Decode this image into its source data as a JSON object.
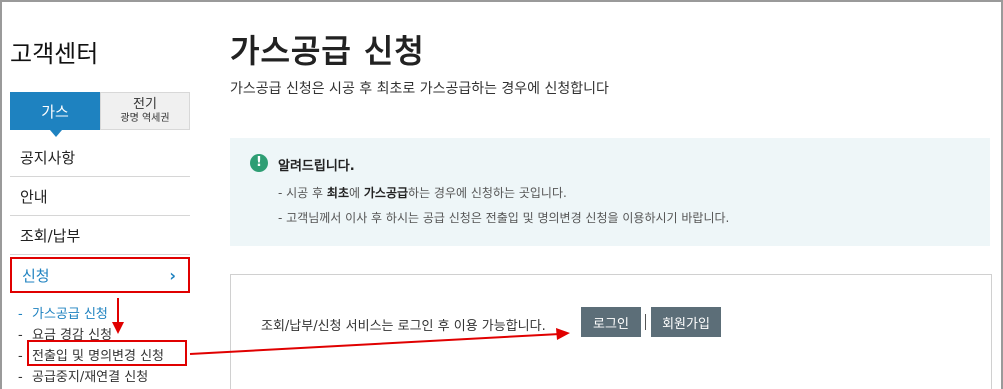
{
  "sidebar": {
    "title": "고객센터",
    "tabs": {
      "gas": "가스",
      "electric": "전기",
      "electric_sub": "광명 역세권"
    },
    "menu": [
      {
        "label": "공지사항"
      },
      {
        "label": "안내"
      },
      {
        "label": "조회/납부"
      },
      {
        "label": "신청",
        "chevron": "›"
      }
    ],
    "submenu": [
      {
        "dash": "-",
        "label": "가스공급 신청"
      },
      {
        "dash": "-",
        "label": "요금 경감 신청"
      },
      {
        "dash": "-",
        "label": "전출입 및 명의변경 신청"
      },
      {
        "dash": "-",
        "label": "공급중지/재연결 신청"
      }
    ]
  },
  "main": {
    "title": "가스공급 신청",
    "subtitle": "가스공급 신청은 시공 후 최초로 가스공급하는 경우에 신청합니다",
    "notice": {
      "icon": "!",
      "title": "알려드립니다.",
      "line1_pre": "- 시공 후 ",
      "line1_b1": "최초",
      "line1_mid": "에 ",
      "line1_b2": "가스공급",
      "line1_post": "하는 경우에 신청하는 곳입니다.",
      "line2": "- 고객님께서 이사 후 하시는 공급 신청은 전출입 및 명의변경 신청을 이용하시기 바랍니다."
    },
    "login": {
      "text": "조회/납부/신청 서비스는 로그인 후 이용 가능합니다.",
      "login_button": "로그인",
      "join_button": "회원가입"
    }
  },
  "colors": {
    "accent": "#1e82c0",
    "annotation": "#e00000",
    "button": "#5c6e78",
    "notice_bg": "#eef6f8",
    "notice_icon": "#2e9e74"
  }
}
